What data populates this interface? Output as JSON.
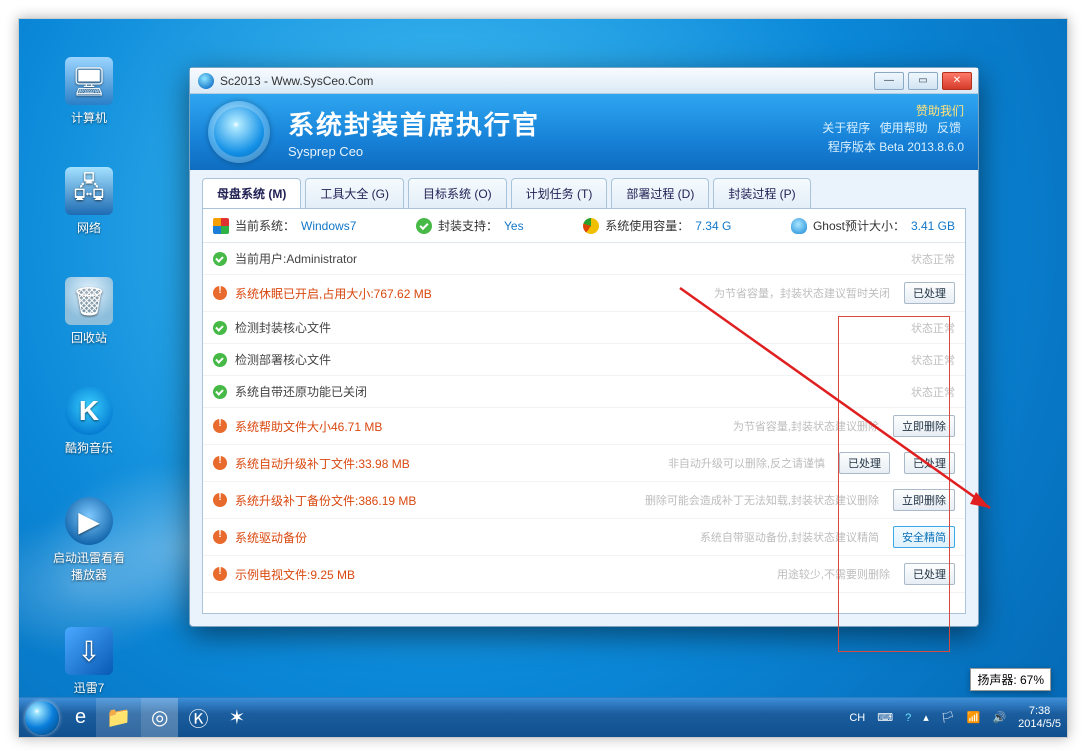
{
  "desktop_icons": {
    "computer": "计算机",
    "network": "网络",
    "recycle": "回收站",
    "kugou": "酷狗音乐",
    "player": "启动迅雷看看\n播放器",
    "xunlei": "迅雷7"
  },
  "speaker_badge": "扬声器: 67%",
  "taskbar": {
    "lang": "CH",
    "clock_time": "7:38",
    "clock_date": "2014/5/5"
  },
  "window": {
    "title": "Sc2013 - Www.SysCeo.Com",
    "header_title": "系统封装首席执行官",
    "header_sub": "Sysprep  Ceo",
    "sponsor": "赞助我们",
    "link_about": "关于程序",
    "link_help": "使用帮助",
    "link_feedback": "反馈",
    "version": "程序版本 Beta 2013.8.6.0"
  },
  "tabs": [
    "母盘系统 (M)",
    "工具大全 (G)",
    "目标系统 (O)",
    "计划任务 (T)",
    "部署过程 (D)",
    "封装过程 (P)"
  ],
  "status": {
    "os_label": "当前系统：",
    "os_value": "Windows7",
    "pack_label": "封装支持：",
    "pack_value": "Yes",
    "usage_label": "系统使用容量：",
    "usage_value": "7.34 G",
    "ghost_label": "Ghost预计大小：",
    "ghost_value": "3.41 GB"
  },
  "rows": [
    {
      "kind": "ok",
      "title": "当前用户:Administrator",
      "hint": "",
      "status": "状态正常",
      "btns": []
    },
    {
      "kind": "warn",
      "title": "系统休眠已开启,占用大小:767.62 MB",
      "hint": "为节省容量，封装状态建议暂时关闭",
      "status": "",
      "btns": [
        "已处理"
      ]
    },
    {
      "kind": "ok",
      "title": "检测封装核心文件",
      "hint": "",
      "status": "状态正常",
      "btns": []
    },
    {
      "kind": "ok",
      "title": "检测部署核心文件",
      "hint": "",
      "status": "状态正常",
      "btns": []
    },
    {
      "kind": "ok",
      "title": "系统自带还原功能已关闭",
      "hint": "",
      "status": "状态正常",
      "btns": []
    },
    {
      "kind": "warn",
      "title": "系统帮助文件大小46.71 MB",
      "hint": "为节省容量,封装状态建议删除",
      "status": "",
      "btns": [
        "立即删除"
      ]
    },
    {
      "kind": "warn",
      "title": "系统自动升级补丁文件:33.98 MB",
      "hint": "非自动升级可以删除,反之请谨慎",
      "status": "",
      "btns": [
        "已处理",
        "已处理"
      ]
    },
    {
      "kind": "warn",
      "title": "系统升级补丁备份文件:386.19 MB",
      "hint": "删除可能会造成补丁无法知载,封装状态建议删除",
      "status": "",
      "btns": [
        "立即删除"
      ]
    },
    {
      "kind": "warn",
      "title": "系统驱动备份",
      "hint": "系统自带驱动备份,封装状态建议精简",
      "status": "",
      "btns": [
        "安全精简"
      ]
    },
    {
      "kind": "warn",
      "title": "示例电视文件:9.25 MB",
      "hint": "用途较少,不需要则删除",
      "status": "",
      "btns": [
        "已处理"
      ]
    }
  ],
  "btn_accent": "安全精简"
}
